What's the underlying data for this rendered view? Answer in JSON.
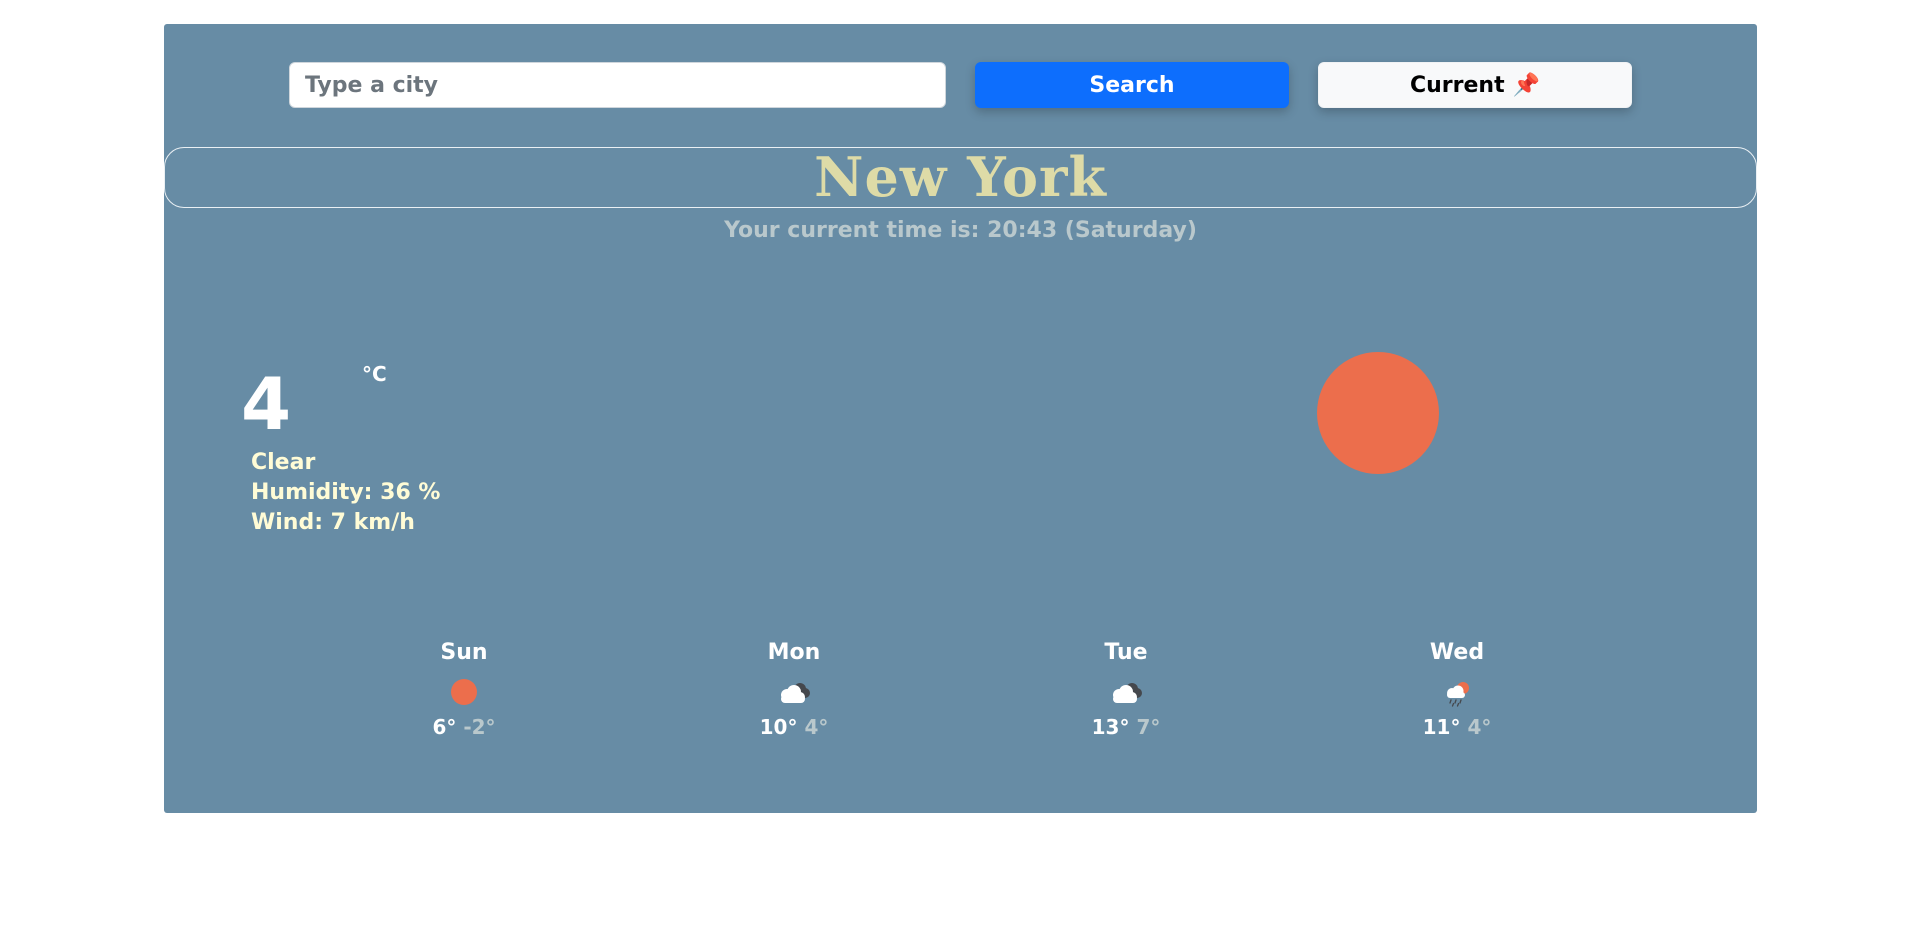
{
  "search": {
    "placeholder": "Type a city",
    "value": "",
    "button_label": "Search"
  },
  "current_button": {
    "label": "Current",
    "icon": "pushpin-icon",
    "glyph": "📌"
  },
  "city": {
    "name": "New York"
  },
  "time": {
    "text": "Your current time is: 20:43 (Saturday)"
  },
  "current_weather": {
    "temperature": "4",
    "unit": "°C",
    "condition": "Clear",
    "humidity": "Humidity: 36 %",
    "wind": "Wind: 7 km/h",
    "icon": "sun-icon"
  },
  "colors": {
    "card_background": "#678ca5",
    "city_name": "#dedba7",
    "details_text": "#fffcd6",
    "sun": "#ec6e4c",
    "search_button": "#0d6efd",
    "min_temp": "#b9c8cc"
  },
  "forecast": [
    {
      "day": "Sun",
      "max": "6°",
      "min": "-2°",
      "icon": "sun-icon"
    },
    {
      "day": "Mon",
      "max": "10°",
      "min": "4°",
      "icon": "cloudy-icon"
    },
    {
      "day": "Tue",
      "max": "13°",
      "min": "7°",
      "icon": "cloudy-icon"
    },
    {
      "day": "Wed",
      "max": "11°",
      "min": "4°",
      "icon": "rain-sun-icon"
    }
  ]
}
